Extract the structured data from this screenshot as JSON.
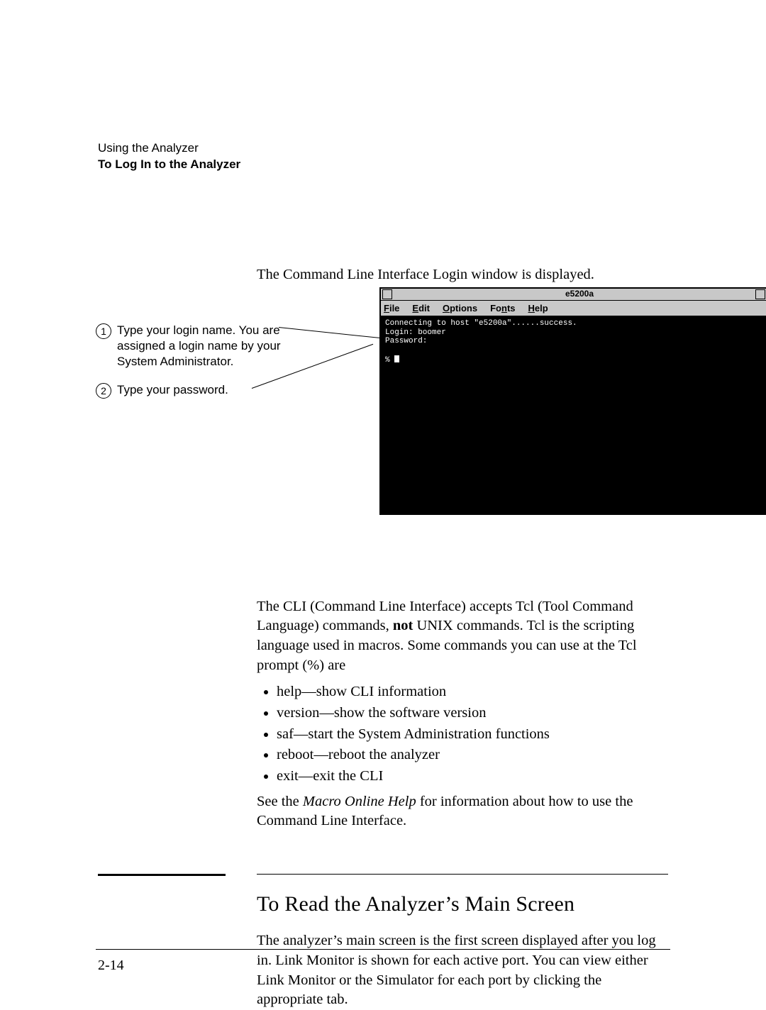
{
  "header": {
    "line1": "Using the Analyzer",
    "line2": "To Log In to the Analyzer"
  },
  "intro_sentence": "The Command Line Interface Login window is displayed.",
  "callouts": [
    {
      "num": "1",
      "text": "Type your login name. You are assigned a login name by your System Administrator."
    },
    {
      "num": "2",
      "text": "Type your password."
    }
  ],
  "window": {
    "title": "e5200a",
    "menus": [
      "File",
      "Edit",
      "Options",
      "Fonts",
      "Help"
    ],
    "menu_underline_idx": [
      0,
      0,
      0,
      2,
      0
    ],
    "term_lines": [
      "Connecting to host \"e5200a\"......success.",
      "Login: boomer",
      "Password:",
      "",
      "% "
    ]
  },
  "cli_para_pre": "The CLI (Command Line Interface) accepts Tcl (Tool Command Language) commands, ",
  "cli_para_bold": "not",
  "cli_para_post": " UNIX commands. Tcl is the scripting language used in macros. Some commands you can use at the Tcl prompt (%) are",
  "cmds": [
    "help—show CLI information",
    "version—show the software version",
    "saf—start the System Administration functions",
    "reboot—reboot the analyzer",
    "exit—exit the CLI"
  ],
  "see_pre": "See the ",
  "see_italic": "Macro Online Help",
  "see_post": " for information about how to use the Command Line Interface.",
  "section_heading": "To Read the Analyzer’s Main Screen",
  "section_para": "The analyzer’s main screen is the first screen displayed after you log in. Link Monitor is shown for each active port. You can view either Link Monitor or the Simulator for each port by clicking the appropriate tab.",
  "page_number": "2-14"
}
